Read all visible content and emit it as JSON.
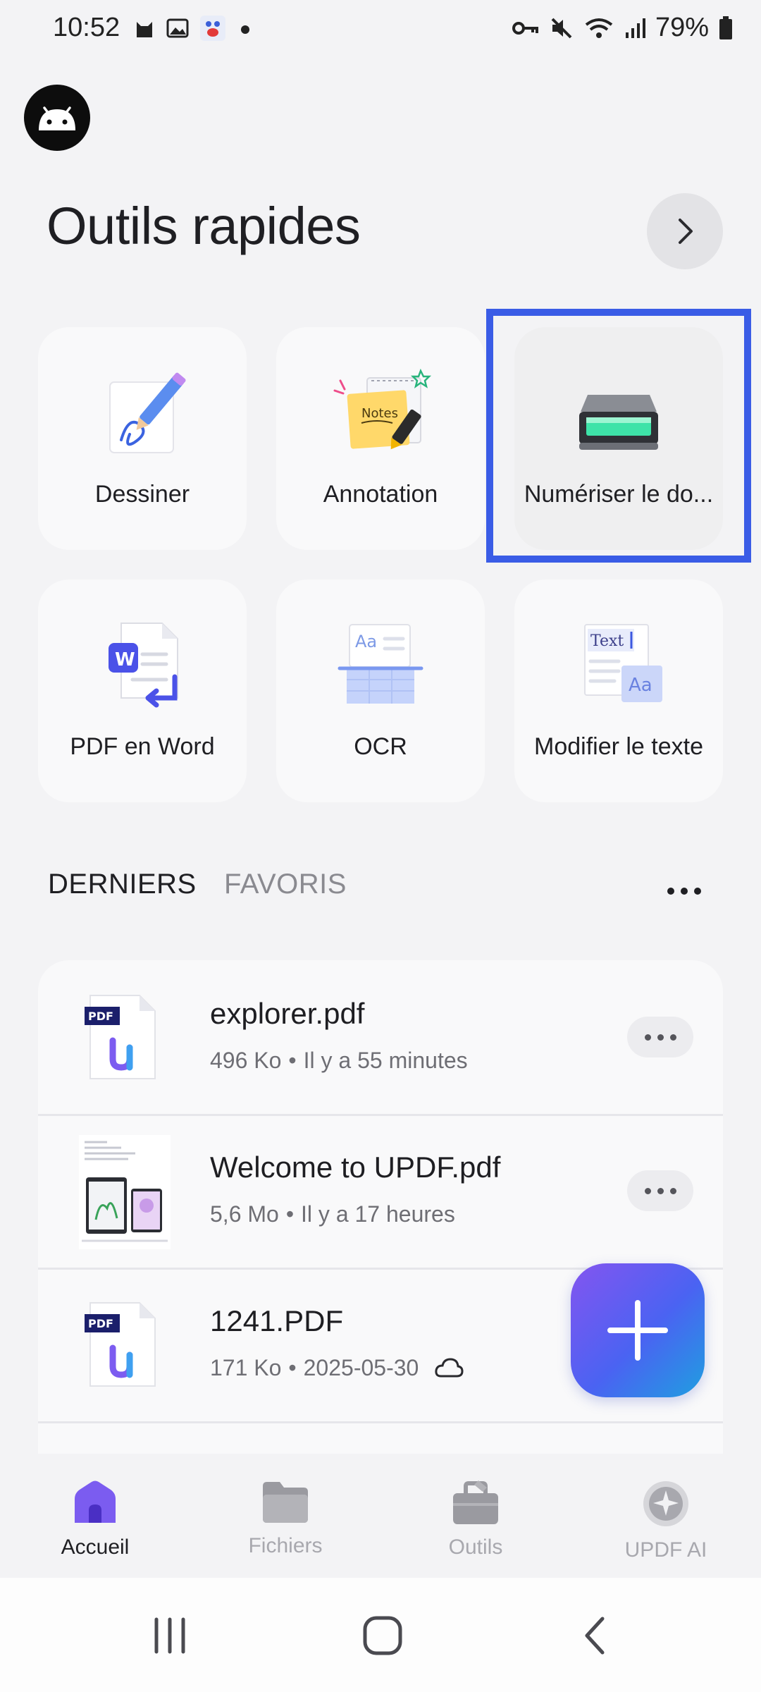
{
  "status_bar": {
    "time": "10:52",
    "battery": "79%",
    "icons_left": [
      "cat-icon",
      "image-icon",
      "paw-icon",
      "dot-icon"
    ],
    "icons_right": [
      "key-icon",
      "mute-icon",
      "wifi-icon",
      "signal-icon",
      "battery-icon"
    ]
  },
  "header": {
    "title": "Outils rapides",
    "avatar_icon": "android-icon",
    "arrow_icon": "chevron-right-icon"
  },
  "tools": [
    {
      "label": "Dessiner",
      "icon": "draw-icon"
    },
    {
      "label": "Annotation",
      "icon": "annotation-icon"
    },
    {
      "label": "Numériser le do...",
      "icon": "scanner-icon",
      "selected": true
    },
    {
      "label": "PDF en Word",
      "icon": "pdf-to-word-icon"
    },
    {
      "label": "OCR",
      "icon": "ocr-icon"
    },
    {
      "label": "Modifier le texte",
      "icon": "edit-text-icon"
    }
  ],
  "tool_icon_text": {
    "notes": "Notes",
    "word": "W",
    "ocr_aa": "Aa",
    "edit_text": "Text",
    "edit_aa": "Aa"
  },
  "tabs": {
    "recent": "DERNIERS",
    "favorites": "FAVORIS",
    "more": "..."
  },
  "files": [
    {
      "name": "explorer.pdf",
      "size": "496 Ko",
      "sep": "•",
      "time": "Il y a 55 minutes",
      "thumb": "pdf",
      "badge": "PDF"
    },
    {
      "name": "Welcome to UPDF.pdf",
      "size": "5,6 Mo",
      "sep": "•",
      "time": "Il y a 17 heures",
      "thumb": "preview",
      "badge": ""
    },
    {
      "name": "1241.PDF",
      "size": "171 Ko",
      "sep": "•",
      "time": "2025-05-30",
      "thumb": "pdf",
      "badge": "PDF",
      "cloud": true
    }
  ],
  "fab": {
    "icon": "plus-icon"
  },
  "bottom_nav": [
    {
      "label": "Accueil",
      "icon": "home-icon",
      "active": true
    },
    {
      "label": "Fichiers",
      "icon": "folder-icon",
      "active": false
    },
    {
      "label": "Outils",
      "icon": "toolbox-icon",
      "active": false
    },
    {
      "label": "UPDF AI",
      "icon": "ai-icon",
      "active": false
    }
  ],
  "system_nav": [
    "recents-icon",
    "home-circle-icon",
    "back-icon"
  ],
  "colors": {
    "accent": "#3a5ce6",
    "fab_start": "#8455f0",
    "fab_end": "#1f9fe0",
    "home_active": "#7b5cf0"
  }
}
